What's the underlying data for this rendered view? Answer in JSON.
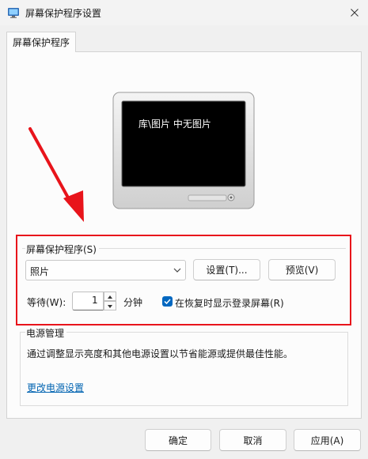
{
  "window": {
    "title": "屏幕保护程序设置"
  },
  "tab": {
    "label": "屏幕保护程序"
  },
  "preview": {
    "text": "库\\图片 中无图片"
  },
  "screensaver": {
    "group_label": "屏幕保护程序(S)",
    "selected": "照片",
    "settings_button": "设置(T)...",
    "preview_button": "预览(V)",
    "wait_label": "等待(W):",
    "wait_value": "1",
    "minutes_label": "分钟",
    "resume_checkbox_label": "在恢复时显示登录屏幕(R)",
    "resume_checked": true
  },
  "power": {
    "title": "电源管理",
    "description": "通过调整显示亮度和其他电源设置以节省能源或提供最佳性能。",
    "link": "更改电源设置"
  },
  "footer": {
    "ok": "确定",
    "cancel": "取消",
    "apply": "应用(A)"
  },
  "colors": {
    "accent": "#0067c0",
    "highlight": "#e8141b",
    "link": "#0063b1"
  }
}
